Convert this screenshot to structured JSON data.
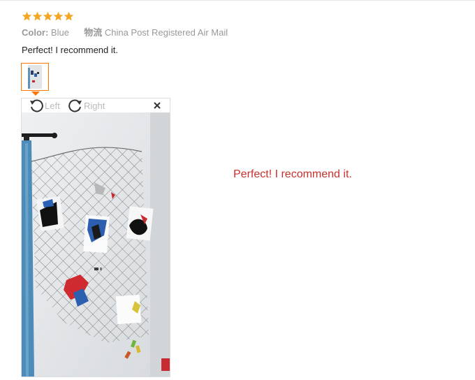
{
  "rating": {
    "stars": 5,
    "max": 5,
    "icon": "star-icon",
    "color": "#f5a623"
  },
  "meta": {
    "color_label": "Color:",
    "color_value": "Blue",
    "shipping_label": "物流",
    "shipping_value": "China Post Registered Air Mail"
  },
  "review": {
    "text": "Perfect! I recommend it."
  },
  "viewer": {
    "rotate_left_label": "Left",
    "rotate_right_label": "Right",
    "rotate_left_icon": "rotate-left-icon",
    "rotate_right_icon": "rotate-right-icon",
    "close_icon": "close-icon",
    "caption": "Perfect! I recommend it."
  },
  "colors": {
    "accent": "#ff7300",
    "caption": "#c9302c",
    "muted": "#999999"
  }
}
